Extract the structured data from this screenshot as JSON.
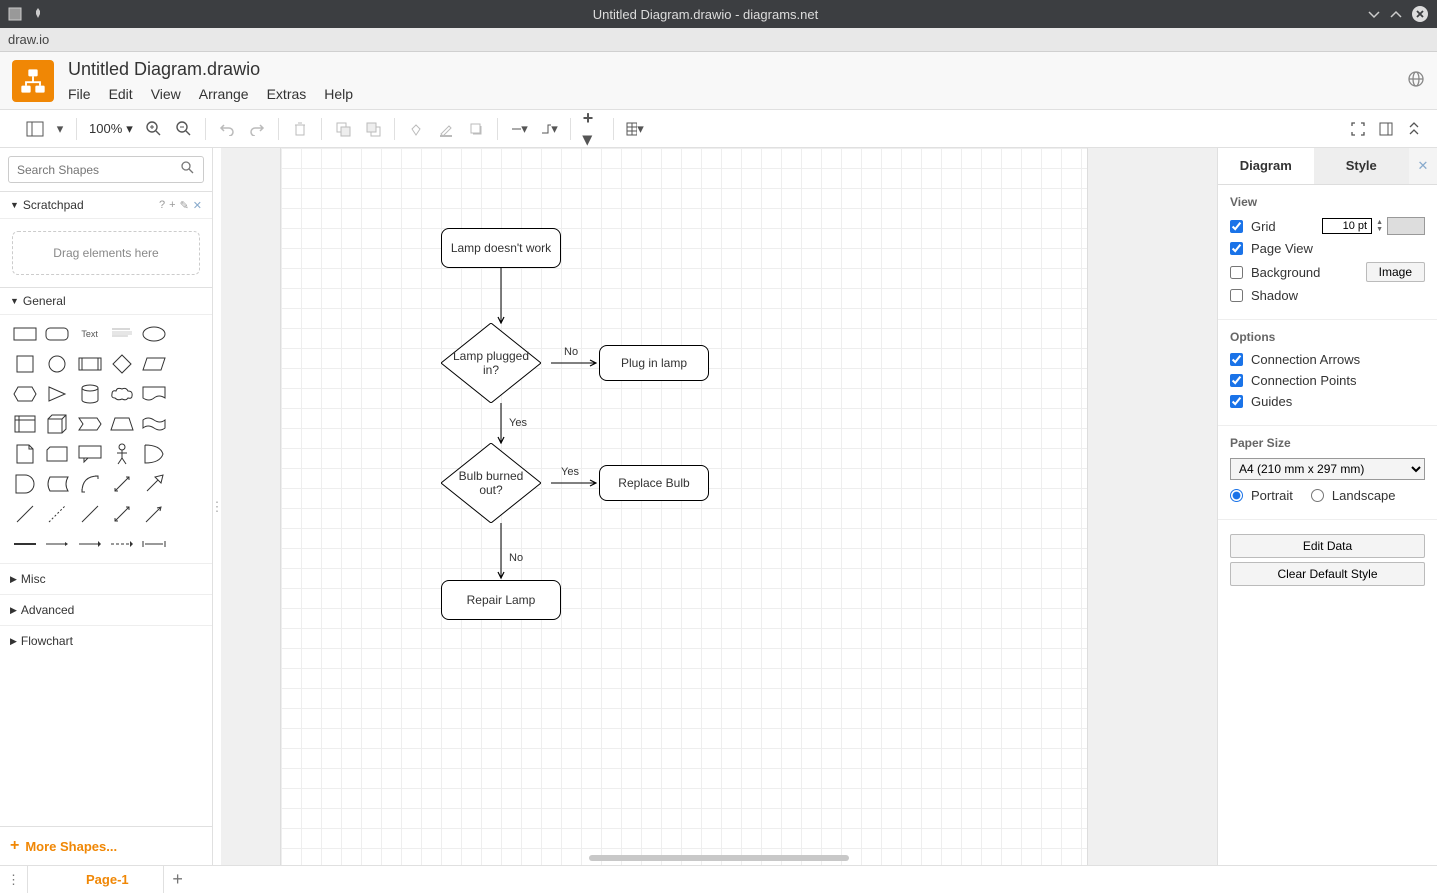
{
  "window": {
    "title": "Untitled Diagram.drawio - diagrams.net",
    "app_label": "draw.io"
  },
  "document": {
    "title": "Untitled Diagram.drawio"
  },
  "main_menu": [
    "File",
    "Edit",
    "View",
    "Arrange",
    "Extras",
    "Help"
  ],
  "toolbar": {
    "zoom": "100%"
  },
  "sidebar": {
    "search_placeholder": "Search Shapes",
    "scratchpad": {
      "title": "Scratchpad",
      "hint": "Drag elements here"
    },
    "sections": {
      "general": "General",
      "misc": "Misc",
      "advanced": "Advanced",
      "flowchart": "Flowchart"
    },
    "more_shapes": "More Shapes..."
  },
  "diagram": {
    "nodes": {
      "start": "Lamp doesn't work",
      "plugged": "Lamp plugged in?",
      "plugin": "Plug in lamp",
      "bulb": "Bulb burned out?",
      "replace": "Replace Bulb",
      "repair": "Repair Lamp"
    },
    "edges": {
      "no1": "No",
      "yes1": "Yes",
      "yes2": "Yes",
      "no2": "No"
    }
  },
  "right_panel": {
    "tabs": {
      "diagram": "Diagram",
      "style": "Style"
    },
    "view": {
      "title": "View",
      "grid": "Grid",
      "grid_value": "10 pt",
      "page_view": "Page View",
      "background": "Background",
      "image_btn": "Image",
      "shadow": "Shadow",
      "checks": {
        "grid": true,
        "page_view": true,
        "background": false,
        "shadow": false
      }
    },
    "options": {
      "title": "Options",
      "conn_arrows": "Connection Arrows",
      "conn_points": "Connection Points",
      "guides": "Guides",
      "checks": {
        "conn_arrows": true,
        "conn_points": true,
        "guides": true
      }
    },
    "paper": {
      "title": "Paper Size",
      "selected": "A4 (210 mm x 297 mm)",
      "portrait": "Portrait",
      "landscape": "Landscape",
      "orientation": "portrait"
    },
    "buttons": {
      "edit_data": "Edit Data",
      "clear_style": "Clear Default Style"
    }
  },
  "bottom": {
    "page_tab": "Page-1"
  }
}
